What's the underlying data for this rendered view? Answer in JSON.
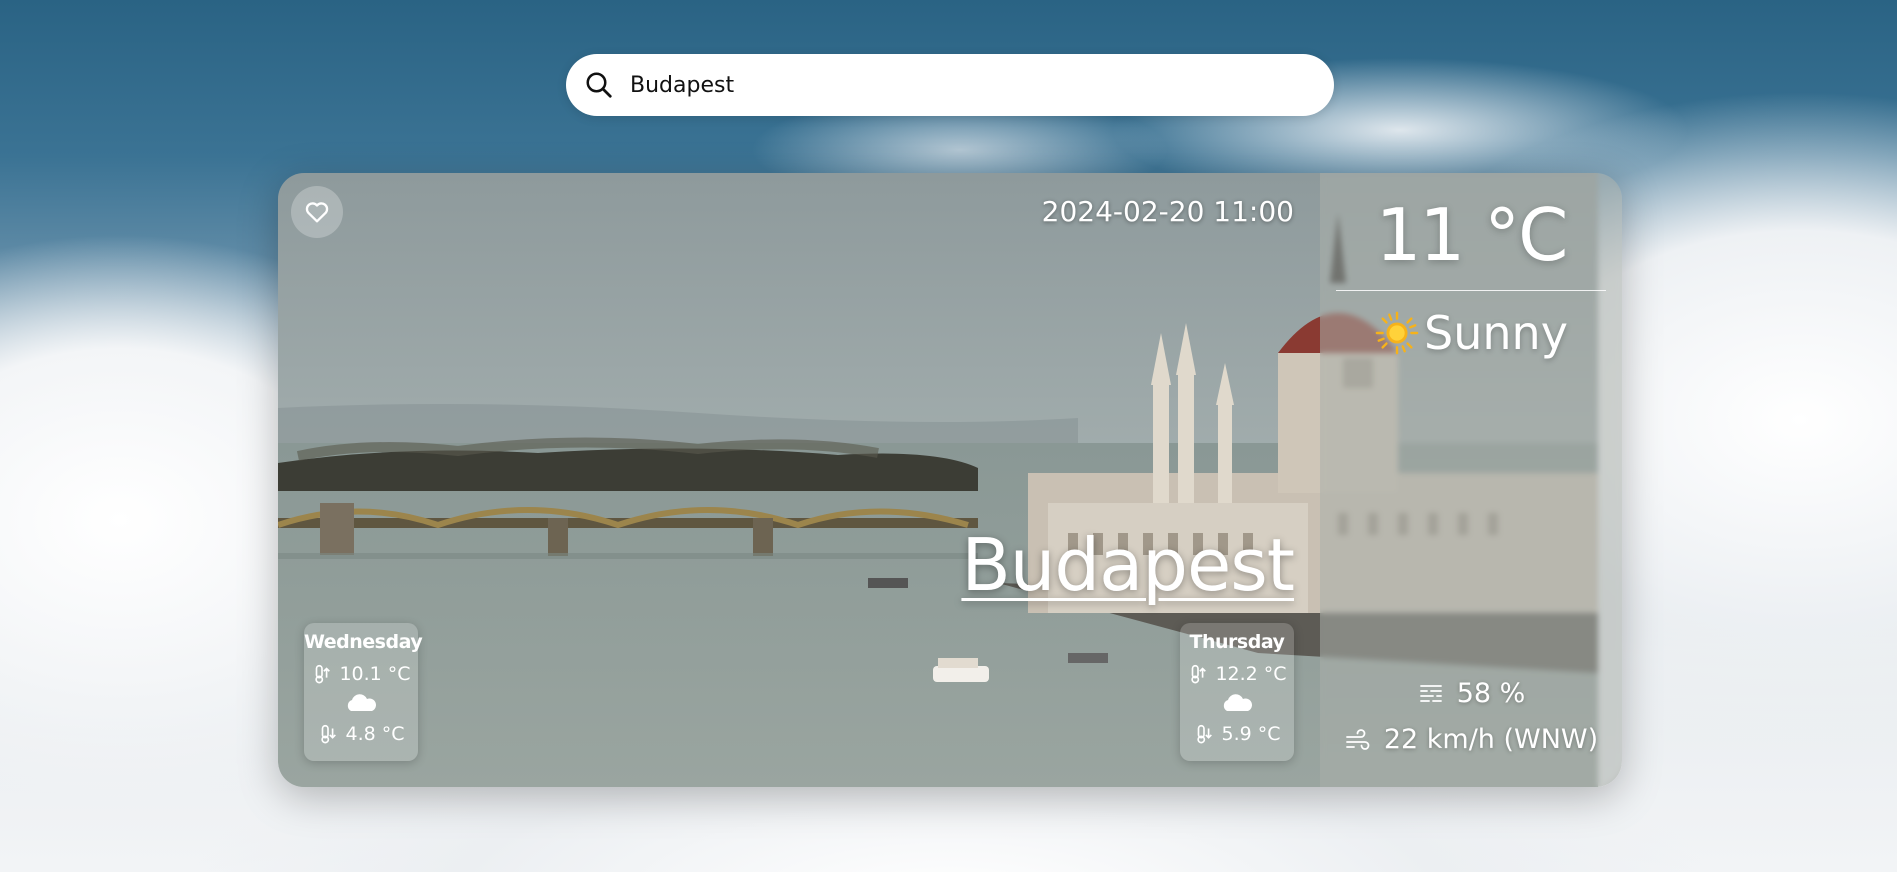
{
  "search": {
    "value": "Budapest",
    "icon": "search-icon"
  },
  "card": {
    "datetime": "2024-02-20 11:00",
    "city": "Budapest",
    "favorite_icon": "heart-icon"
  },
  "current": {
    "temperature": "11 °C",
    "condition": "Sunny",
    "condition_icon": "sun-icon",
    "humidity": "58 %",
    "humidity_icon": "humidity-icon",
    "wind": "22 km/h (WNW)",
    "wind_icon": "wind-icon"
  },
  "forecast": [
    {
      "day": "Wednesday",
      "max": "10.1 °C",
      "min": "4.8 °C",
      "icon": "cloud-icon"
    },
    {
      "day": "Thursday",
      "max": "12.2 °C",
      "min": "5.9 °C",
      "icon": "cloud-icon"
    }
  ],
  "colors": {
    "sun": "#f6b21a",
    "panel_text": "#ffffff",
    "search_bg": "#ffffff"
  }
}
